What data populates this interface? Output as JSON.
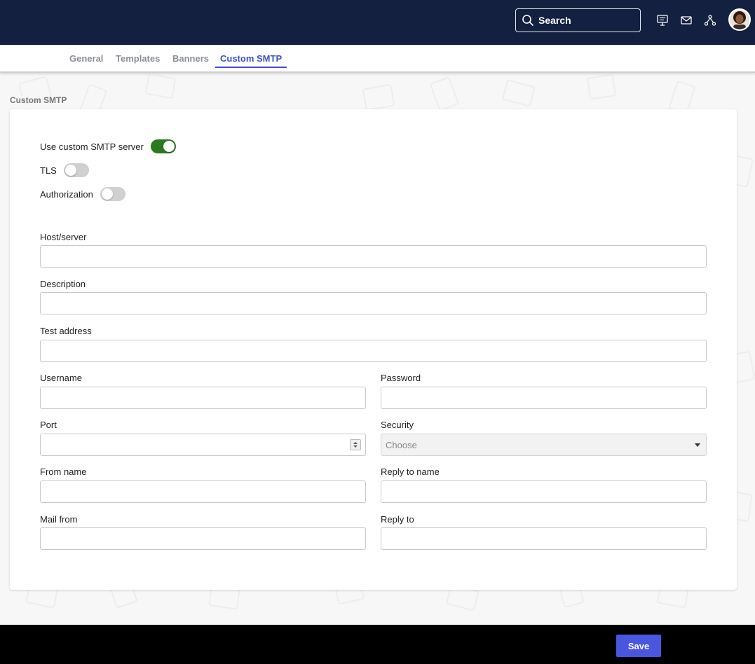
{
  "header": {
    "search_label": "Search"
  },
  "tabs": [
    {
      "label": "General"
    },
    {
      "label": "Templates"
    },
    {
      "label": "Banners"
    },
    {
      "label": "Custom SMTP",
      "active": true
    }
  ],
  "section_title": "Custom SMTP",
  "toggles": {
    "use_custom": {
      "label": "Use custom SMTP server",
      "on": true
    },
    "tls": {
      "label": "TLS",
      "on": false
    },
    "authorization": {
      "label": "Authorization",
      "on": false
    }
  },
  "fields": {
    "host": {
      "label": "Host/server",
      "value": ""
    },
    "description": {
      "label": "Description",
      "value": ""
    },
    "test_address": {
      "label": "Test address",
      "value": ""
    },
    "username": {
      "label": "Username",
      "value": ""
    },
    "password": {
      "label": "Password",
      "value": ""
    },
    "port": {
      "label": "Port",
      "value": ""
    },
    "security": {
      "label": "Security",
      "value": "Choose"
    },
    "from_name": {
      "label": "From name",
      "value": ""
    },
    "reply_to_name": {
      "label": "Reply to name",
      "value": ""
    },
    "mail_from": {
      "label": "Mail from",
      "value": ""
    },
    "reply_to": {
      "label": "Reply to",
      "value": ""
    }
  },
  "footer": {
    "save_label": "Save"
  },
  "colors": {
    "header_bg": "#132040",
    "accent": "#3d4fcf",
    "toggle_on": "#2a7a1f",
    "save_button": "#4a55e0"
  }
}
